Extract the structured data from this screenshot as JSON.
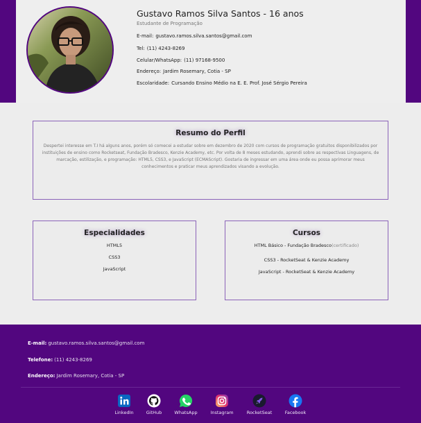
{
  "profile": {
    "name": "Gustavo Ramos Silva Santos - 16 anos",
    "role": "Estudante de Programação",
    "info": [
      {
        "label": "E-mail:",
        "value": "gustavo.ramos.silva.santos@gmail.com"
      },
      {
        "label": "Tel:",
        "value": "(11) 4243-8269"
      },
      {
        "label": "Celular/WhatsApp:",
        "value": "(11) 97168-9500"
      },
      {
        "label": "Endereço:",
        "value": "Jardim Rosemary, Cotia - SP"
      },
      {
        "label": "Escolaridade:",
        "value": "Cursando Ensino Médio na E. E. Prof. José Sérgio Pereira"
      }
    ]
  },
  "summary": {
    "title": "Resumo do Perfil",
    "text": "Despertei interesse em T.I há alguns anos, porém só comecei a estudar sobre em dezembro de 2020 com cursos de programação gratuitos disponibilizados por instituições de ensino como Rocketseat, Fundação Bradesco, Kenzie Academy, etc. Por volta de 8 meses estudando, aprendi sobre as respectivas Linguagens, de marcação, estilização, e programação: HTML5, CSS3, e JavaScript (ECMAScript). Gostaria de ingressar em uma área onde eu possa aprimorar meus conhecimentos e praticar meus aprendizados visando a evolução."
  },
  "specialties": {
    "title": "Especialidades",
    "items": [
      "HTML5",
      "CSS3",
      "JavaScript"
    ]
  },
  "courses": {
    "title": "Cursos",
    "items": [
      {
        "name": "HTML Básico - Fundação Bradesco",
        "note": "(certificado)"
      },
      {
        "name": "CSS3 - RocketSeat & Kenzie Academy",
        "note": ""
      },
      {
        "name": "JavaScript - RocketSeat & Kenzie Academy",
        "note": ""
      }
    ]
  },
  "footer": {
    "contacts": [
      {
        "label": "E-mail:",
        "value": "gustavo.ramos.silva.santos@gmail.com"
      },
      {
        "label": "Telefone:",
        "value": "(11) 4243-8269"
      },
      {
        "label": "Endereço:",
        "value": "Jardim Rosemary, Cotia - SP"
      }
    ],
    "social": [
      {
        "label": "LinkedIn",
        "icon": "linkedin-icon",
        "color": "#0a66c2"
      },
      {
        "label": "GitHub",
        "icon": "github-icon",
        "color": "#ffffff"
      },
      {
        "label": "WhatsApp",
        "icon": "whatsapp-icon",
        "color": "#25d366"
      },
      {
        "label": "Instagram",
        "icon": "instagram-icon",
        "color": "#e1306c"
      },
      {
        "label": "RocketSeat",
        "icon": "rocketseat-icon",
        "color": "#1a1a2e"
      },
      {
        "label": "Facebook",
        "icon": "facebook-icon",
        "color": "#1877f2"
      }
    ]
  },
  "colors": {
    "accent": "#52067f",
    "border": "#8a62b8"
  }
}
